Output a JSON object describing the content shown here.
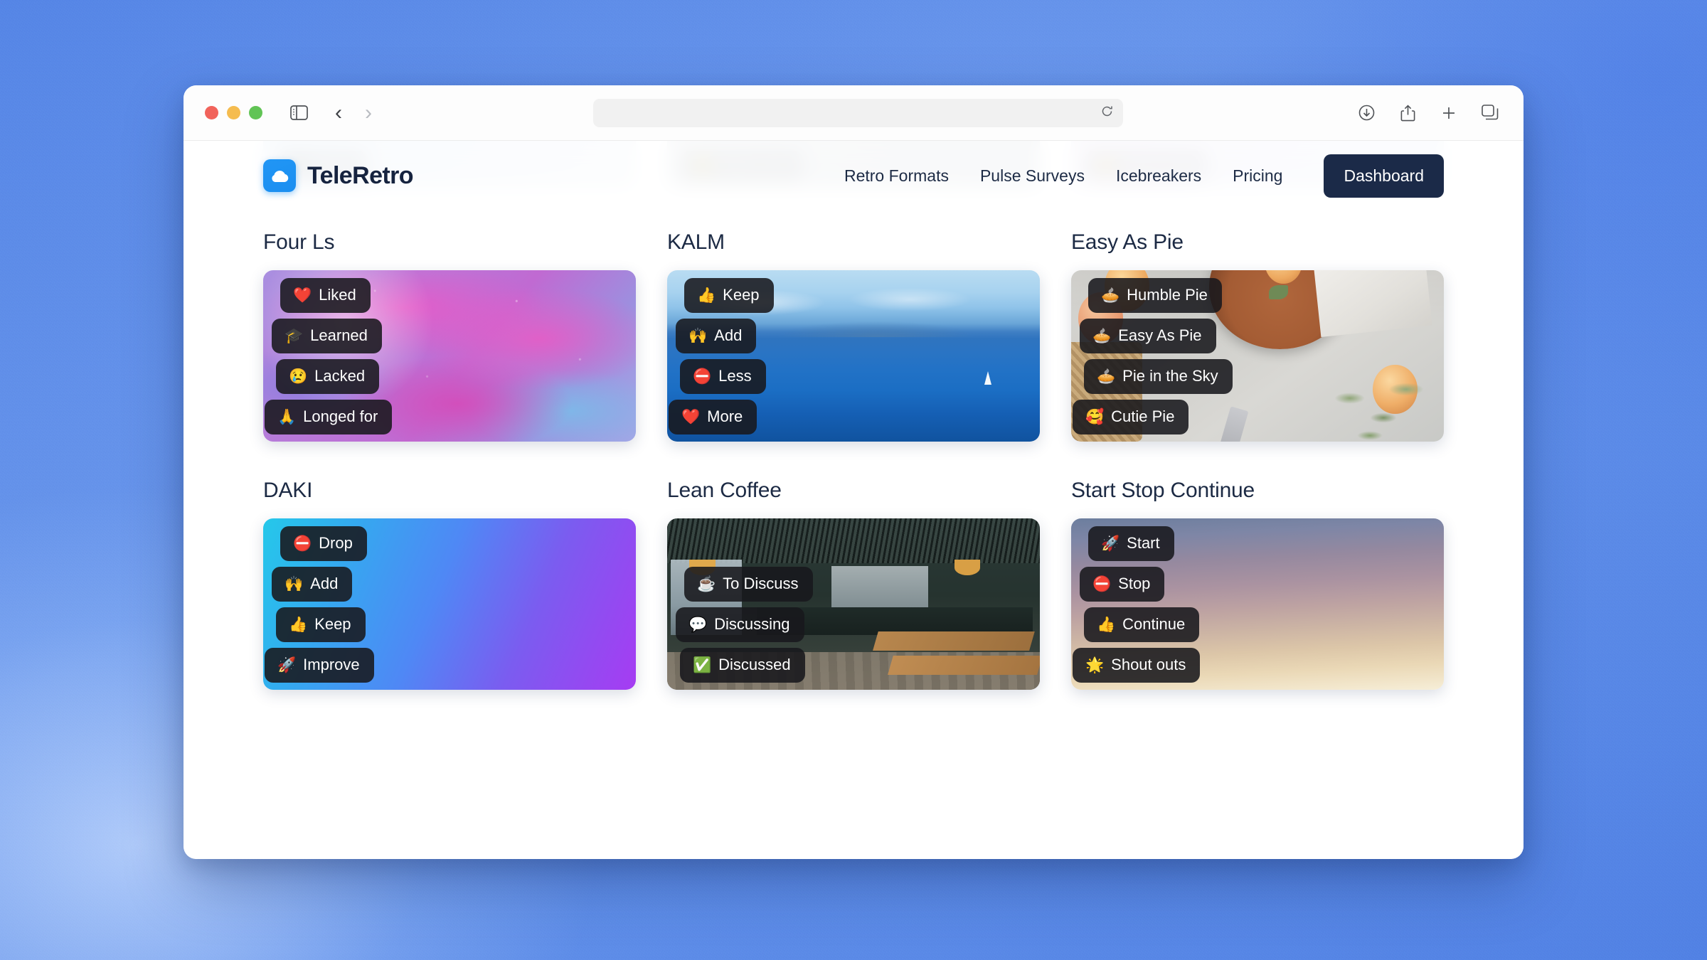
{
  "browser": {
    "traffic_lights": [
      "close",
      "minimize",
      "zoom"
    ],
    "sidebar_icon": "sidebar-icon",
    "back_icon": "chevron-left-icon",
    "forward_icon": "chevron-right-icon",
    "shield_icon": "privacy-shield-icon",
    "address_value": "",
    "address_placeholder": "",
    "reload_icon": "reload-icon",
    "downloads_icon": "downloads-icon",
    "share_icon": "share-icon",
    "new_tab_icon": "plus-icon",
    "tabs_icon": "tab-overview-icon"
  },
  "site_header": {
    "brand_name": "TeleRetro",
    "brand_icon": "cloud-icon",
    "brand_color": "#1a8ef0",
    "nav": [
      {
        "label": "Retro Formats"
      },
      {
        "label": "Pulse Surveys"
      },
      {
        "label": "Icebreakers"
      },
      {
        "label": "Pricing"
      }
    ],
    "cta_label": "Dashboard",
    "cta_color": "#1b2a48"
  },
  "ghost_row": [
    {
      "chip_emoji": "🏝️",
      "chip_label": "Island"
    },
    {
      "chip_emoji": "🌟",
      "chip_label": "Shout outs"
    },
    {
      "chip_emoji": "🌟",
      "chip_label": "Shout outs"
    }
  ],
  "formats": [
    {
      "title": "Four Ls",
      "art": "nebula",
      "chips": [
        {
          "emoji": "❤️",
          "label": "Liked"
        },
        {
          "emoji": "🎓",
          "label": "Learned"
        },
        {
          "emoji": "😢",
          "label": "Lacked"
        },
        {
          "emoji": "🙏",
          "label": "Longed for"
        }
      ]
    },
    {
      "title": "KALM",
      "art": "ocean",
      "chips": [
        {
          "emoji": "👍",
          "label": "Keep"
        },
        {
          "emoji": "🙌",
          "label": "Add"
        },
        {
          "emoji": "⛔",
          "label": "Less"
        },
        {
          "emoji": "❤️",
          "label": "More"
        }
      ]
    },
    {
      "title": "Easy As Pie",
      "art": "flatlay",
      "chips": [
        {
          "emoji": "🥧",
          "label": "Humble Pie"
        },
        {
          "emoji": "🥧",
          "label": "Easy As Pie"
        },
        {
          "emoji": "🥧",
          "label": "Pie in the Sky"
        },
        {
          "emoji": "🥰",
          "label": "Cutie Pie"
        }
      ]
    },
    {
      "title": "DAKI",
      "art": "gradient-daki",
      "chips": [
        {
          "emoji": "⛔",
          "label": "Drop"
        },
        {
          "emoji": "🙌",
          "label": "Add"
        },
        {
          "emoji": "👍",
          "label": "Keep"
        },
        {
          "emoji": "🚀",
          "label": "Improve"
        }
      ]
    },
    {
      "title": "Lean Coffee",
      "art": "cafe",
      "chips": [
        {
          "emoji": "☕",
          "label": "To Discuss"
        },
        {
          "emoji": "💬",
          "label": "Discussing"
        },
        {
          "emoji": "✅",
          "label": "Discussed"
        }
      ]
    },
    {
      "title": "Start Stop Continue",
      "art": "sunset",
      "chips": [
        {
          "emoji": "🚀",
          "label": "Start"
        },
        {
          "emoji": "⛔",
          "label": "Stop"
        },
        {
          "emoji": "👍",
          "label": "Continue"
        },
        {
          "emoji": "🌟",
          "label": "Shout outs"
        }
      ]
    }
  ]
}
